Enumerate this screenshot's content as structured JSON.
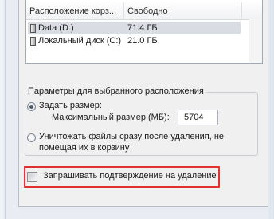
{
  "list": {
    "columns": [
      "Расположение корз...",
      "Свободно"
    ],
    "rows": [
      {
        "name": "Data (D:)",
        "free": "71.4 ГБ",
        "selected": true
      },
      {
        "name": "Локальный диск (C:)",
        "free": "21.0 ГБ",
        "selected": false
      }
    ]
  },
  "settings": {
    "group_title": "Параметры для выбранного расположения",
    "custom_size_label": "Задать размер:",
    "max_size_label": "Максимальный размер (МБ):",
    "max_size_value": "5704",
    "delete_immediately_line1": "Уничтожать файлы сразу после удаления, не",
    "delete_immediately_line2": "помещая их в корзину",
    "confirm_delete_label": "Запрашивать подтверждение на удаление"
  }
}
